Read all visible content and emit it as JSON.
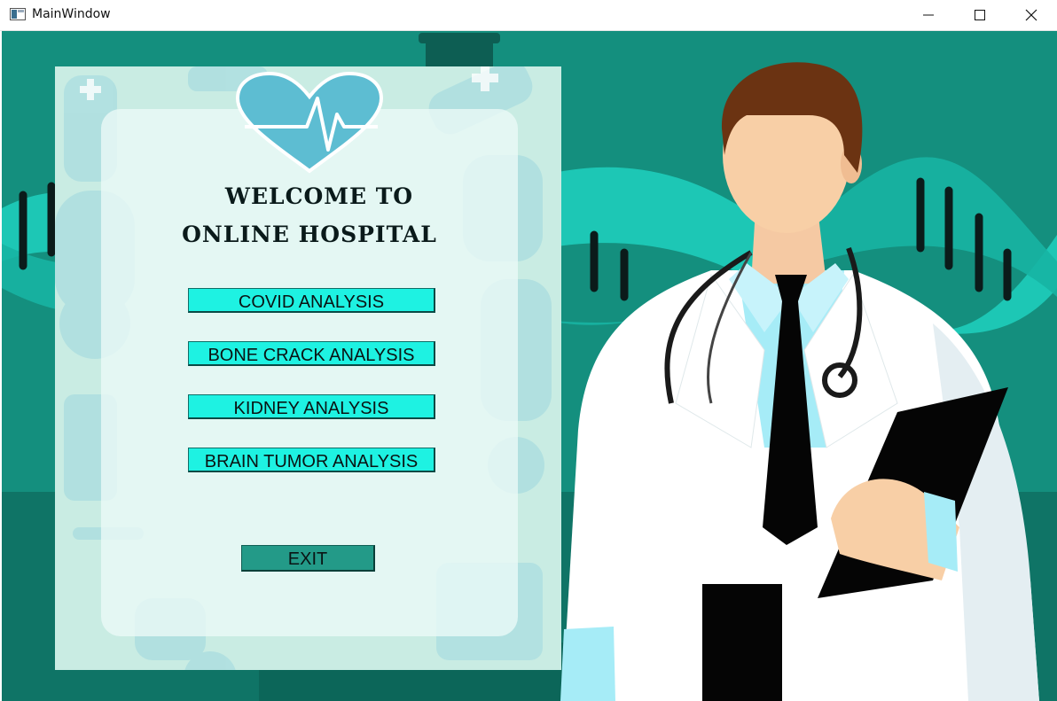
{
  "window": {
    "title": "MainWindow"
  },
  "panel": {
    "welcome_line1": "WELCOME TO",
    "welcome_line2": "ONLINE HOSPITAL"
  },
  "buttons": {
    "covid": "COVID ANALYSIS",
    "bone": "BONE CRACK ANALYSIS",
    "kidney": "KIDNEY ANALYSIS",
    "brain": "BRAIN TUMOR ANALYSIS",
    "exit": "EXIT"
  },
  "colors": {
    "background_teal": "#148f7e",
    "button_cyan": "#1ef2e2",
    "exit_teal": "#239a88",
    "heart_blue": "#5dbdd2"
  },
  "icons": [
    "app-window-icon",
    "minimize-icon",
    "maximize-icon",
    "close-icon",
    "heartbeat-heart-icon",
    "doctor-illustration"
  ]
}
